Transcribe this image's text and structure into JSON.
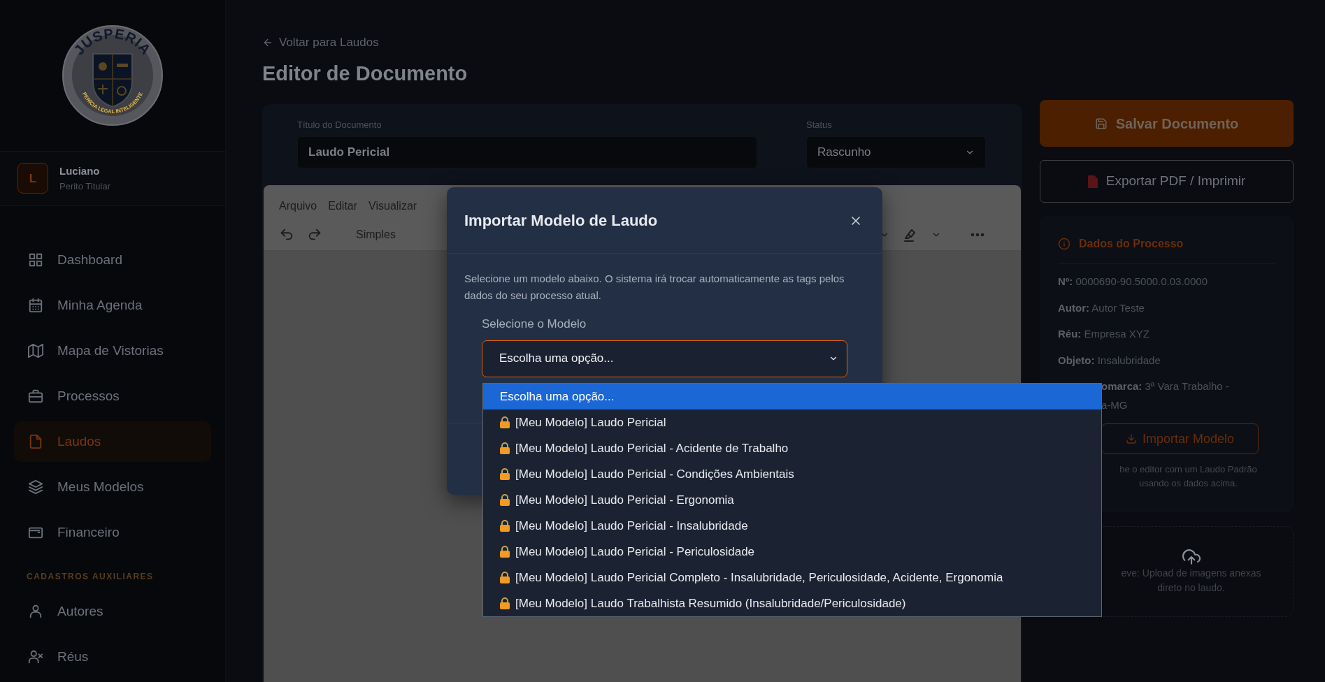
{
  "sidebar": {
    "logo": {
      "top_text": "JUSPERIA",
      "bottom_text": "PERÍCIA LEGAL INTELIGENTE"
    },
    "user": {
      "initial": "L",
      "name": "Luciano",
      "role": "Perito Titular"
    },
    "nav": [
      {
        "label": "Dashboard",
        "selected": false
      },
      {
        "label": "Minha Agenda",
        "selected": false
      },
      {
        "label": "Mapa de Vistorias",
        "selected": false
      },
      {
        "label": "Processos",
        "selected": false
      },
      {
        "label": "Laudos",
        "selected": true
      },
      {
        "label": "Meus Modelos",
        "selected": false
      },
      {
        "label": "Financeiro",
        "selected": false
      }
    ],
    "section_title": "CADASTROS AUXILIARES",
    "aux_nav": [
      {
        "label": "Autores",
        "selected": false
      },
      {
        "label": "Réus",
        "selected": false
      }
    ]
  },
  "page": {
    "back_link": "Voltar para Laudos",
    "title": "Editor de Documento"
  },
  "document_form": {
    "title_label": "Título do Documento",
    "title_value": "Laudo Pericial",
    "status_label": "Status",
    "status_value": "Rascunho"
  },
  "editor": {
    "menu": [
      "Arquivo",
      "Editar",
      "Visualizar"
    ],
    "block_format": "Simples"
  },
  "modal": {
    "title": "Importar Modelo de Laudo",
    "description": "Selecione um modelo abaixo. O sistema irá trocar automaticamente as tags pelos dados do seu processo atual.",
    "select_label": "Selecione o Modelo",
    "select_value": "Escolha uma opção...",
    "options": [
      {
        "label": "Escolha uma opção...",
        "locked": false,
        "selected": true
      },
      {
        "label": "[Meu Modelo] Laudo Pericial",
        "locked": true,
        "selected": false
      },
      {
        "label": "[Meu Modelo] Laudo Pericial - Acidente de Trabalho",
        "locked": true,
        "selected": false
      },
      {
        "label": "[Meu Modelo] Laudo Pericial - Condições Ambientais",
        "locked": true,
        "selected": false
      },
      {
        "label": "[Meu Modelo] Laudo Pericial - Ergonomia",
        "locked": true,
        "selected": false
      },
      {
        "label": "[Meu Modelo] Laudo Pericial - Insalubridade",
        "locked": true,
        "selected": false
      },
      {
        "label": "[Meu Modelo] Laudo Pericial - Periculosidade",
        "locked": true,
        "selected": false
      },
      {
        "label": "[Meu Modelo] Laudo Pericial Completo - Insalubridade, Periculosidade, Acidente, Ergonomia",
        "locked": true,
        "selected": false
      },
      {
        "label": "[Meu Modelo] Laudo Trabalhista Resumido (Insalubridade/Periculosidade)",
        "locked": true,
        "selected": false
      }
    ]
  },
  "actions": {
    "save": "Salvar Documento",
    "export": "Exportar PDF / Imprimir"
  },
  "process_card": {
    "title": "Dados do Processo",
    "fields": [
      {
        "label": "Nº:",
        "value": "0000690-90.5000.0.03.0000"
      },
      {
        "label": "Autor:",
        "value": "Autor Teste"
      },
      {
        "label": "Réu:",
        "value": "Empresa XYZ"
      },
      {
        "label": "Objeto:",
        "value": "Insalubridade"
      }
    ],
    "covered_field": {
      "label": "omarca:",
      "value": "3ª Vara Trabalho -",
      "continuation": "a-MG"
    },
    "import_button": "Importar Modelo",
    "hint_lines": [
      "he o editor com um Laudo Padrão",
      "usando os dados acima."
    ]
  },
  "upload_card": {
    "lines": [
      "eve: Upload de imagens anexas",
      "direto no laudo."
    ]
  }
}
